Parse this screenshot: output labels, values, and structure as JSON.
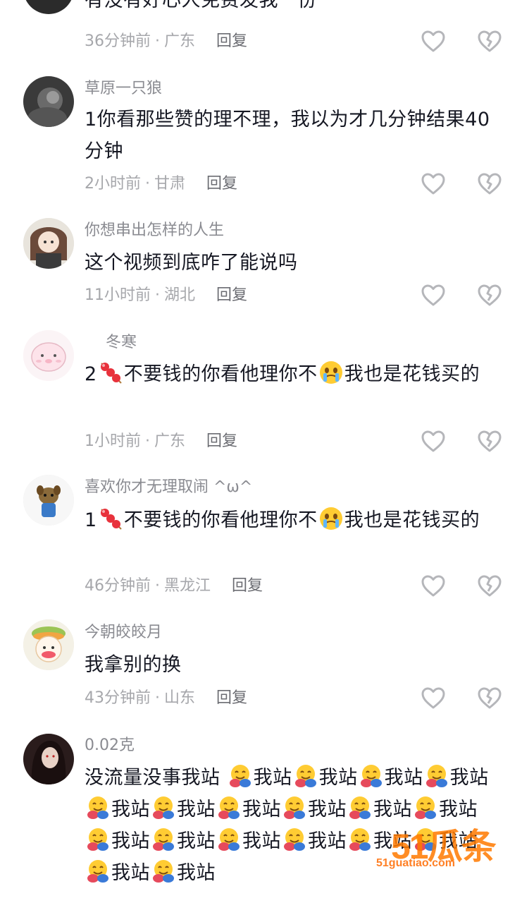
{
  "comments": [
    {
      "username": "",
      "text": "有没有好心人免费发我一份",
      "time": "36分钟前",
      "location": "广东",
      "reply_label": "回复"
    },
    {
      "username": "草原一只狼",
      "text": "1你看那些赞的理不理，我以为才几分钟结果40分钟",
      "time": "2小时前",
      "location": "甘肃",
      "reply_label": "回复"
    },
    {
      "username": "你想串出怎样的人生",
      "text": "这个视频到底咋了能说吗",
      "time": "11小时前",
      "location": "湖北",
      "reply_label": "回复"
    },
    {
      "username": "冬寒",
      "text_prefix": "2",
      "text_mid": "不要钱的你看他理你不",
      "text_suffix": "我也是花钱买的",
      "time": "1小时前",
      "location": "广东",
      "reply_label": "回复"
    },
    {
      "username": "喜欢你才无理取闹 ^ω^",
      "text_prefix": "1",
      "text_mid": "不要钱的你看他理你不",
      "text_suffix": "我也是花钱买的",
      "time": "46分钟前",
      "location": "黑龙江",
      "reply_label": "回复"
    },
    {
      "username": "今朝皎皎月",
      "text": "我拿别的换",
      "time": "43分钟前",
      "location": "山东",
      "reply_label": "回复"
    },
    {
      "username": "0.02克",
      "text_start": "没流量没事我站",
      "repeat_word": "我站"
    }
  ],
  "separator": "·",
  "watermark": {
    "big": "51瓜条",
    "url": "51guatiao.com"
  },
  "colors": {
    "text": "#161823",
    "username": "#8a8b91",
    "meta": "#a6a7ab",
    "icon": "#b5b6ba",
    "watermark": "#ff7a00"
  }
}
